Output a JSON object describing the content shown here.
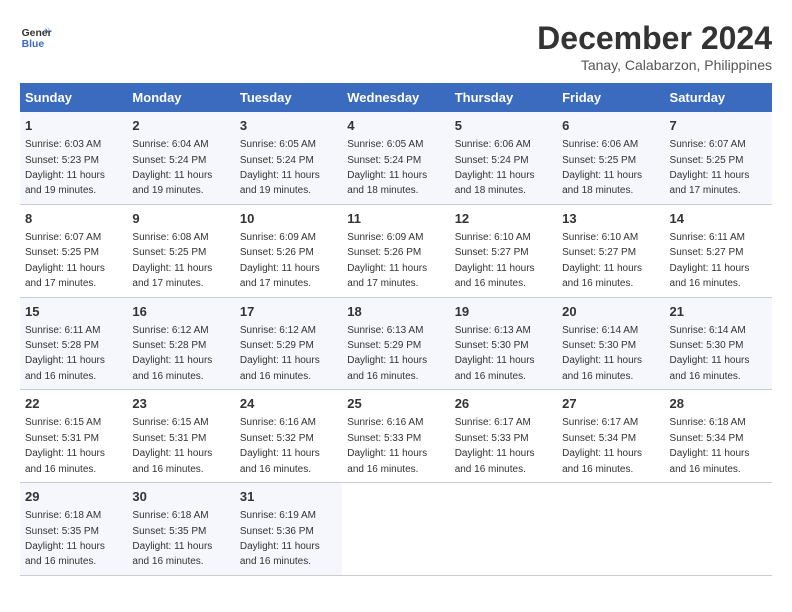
{
  "header": {
    "logo_line1": "General",
    "logo_line2": "Blue",
    "month_year": "December 2024",
    "location": "Tanay, Calabarzon, Philippines"
  },
  "weekdays": [
    "Sunday",
    "Monday",
    "Tuesday",
    "Wednesday",
    "Thursday",
    "Friday",
    "Saturday"
  ],
  "weeks": [
    [
      {
        "day": "1",
        "rise": "6:03 AM",
        "set": "5:23 PM",
        "daylight": "11 hours and 19 minutes."
      },
      {
        "day": "2",
        "rise": "6:04 AM",
        "set": "5:24 PM",
        "daylight": "11 hours and 19 minutes."
      },
      {
        "day": "3",
        "rise": "6:05 AM",
        "set": "5:24 PM",
        "daylight": "11 hours and 19 minutes."
      },
      {
        "day": "4",
        "rise": "6:05 AM",
        "set": "5:24 PM",
        "daylight": "11 hours and 18 minutes."
      },
      {
        "day": "5",
        "rise": "6:06 AM",
        "set": "5:24 PM",
        "daylight": "11 hours and 18 minutes."
      },
      {
        "day": "6",
        "rise": "6:06 AM",
        "set": "5:25 PM",
        "daylight": "11 hours and 18 minutes."
      },
      {
        "day": "7",
        "rise": "6:07 AM",
        "set": "5:25 PM",
        "daylight": "11 hours and 17 minutes."
      }
    ],
    [
      {
        "day": "8",
        "rise": "6:07 AM",
        "set": "5:25 PM",
        "daylight": "11 hours and 17 minutes."
      },
      {
        "day": "9",
        "rise": "6:08 AM",
        "set": "5:25 PM",
        "daylight": "11 hours and 17 minutes."
      },
      {
        "day": "10",
        "rise": "6:09 AM",
        "set": "5:26 PM",
        "daylight": "11 hours and 17 minutes."
      },
      {
        "day": "11",
        "rise": "6:09 AM",
        "set": "5:26 PM",
        "daylight": "11 hours and 17 minutes."
      },
      {
        "day": "12",
        "rise": "6:10 AM",
        "set": "5:27 PM",
        "daylight": "11 hours and 16 minutes."
      },
      {
        "day": "13",
        "rise": "6:10 AM",
        "set": "5:27 PM",
        "daylight": "11 hours and 16 minutes."
      },
      {
        "day": "14",
        "rise": "6:11 AM",
        "set": "5:27 PM",
        "daylight": "11 hours and 16 minutes."
      }
    ],
    [
      {
        "day": "15",
        "rise": "6:11 AM",
        "set": "5:28 PM",
        "daylight": "11 hours and 16 minutes."
      },
      {
        "day": "16",
        "rise": "6:12 AM",
        "set": "5:28 PM",
        "daylight": "11 hours and 16 minutes."
      },
      {
        "day": "17",
        "rise": "6:12 AM",
        "set": "5:29 PM",
        "daylight": "11 hours and 16 minutes."
      },
      {
        "day": "18",
        "rise": "6:13 AM",
        "set": "5:29 PM",
        "daylight": "11 hours and 16 minutes."
      },
      {
        "day": "19",
        "rise": "6:13 AM",
        "set": "5:30 PM",
        "daylight": "11 hours and 16 minutes."
      },
      {
        "day": "20",
        "rise": "6:14 AM",
        "set": "5:30 PM",
        "daylight": "11 hours and 16 minutes."
      },
      {
        "day": "21",
        "rise": "6:14 AM",
        "set": "5:30 PM",
        "daylight": "11 hours and 16 minutes."
      }
    ],
    [
      {
        "day": "22",
        "rise": "6:15 AM",
        "set": "5:31 PM",
        "daylight": "11 hours and 16 minutes."
      },
      {
        "day": "23",
        "rise": "6:15 AM",
        "set": "5:31 PM",
        "daylight": "11 hours and 16 minutes."
      },
      {
        "day": "24",
        "rise": "6:16 AM",
        "set": "5:32 PM",
        "daylight": "11 hours and 16 minutes."
      },
      {
        "day": "25",
        "rise": "6:16 AM",
        "set": "5:33 PM",
        "daylight": "11 hours and 16 minutes."
      },
      {
        "day": "26",
        "rise": "6:17 AM",
        "set": "5:33 PM",
        "daylight": "11 hours and 16 minutes."
      },
      {
        "day": "27",
        "rise": "6:17 AM",
        "set": "5:34 PM",
        "daylight": "11 hours and 16 minutes."
      },
      {
        "day": "28",
        "rise": "6:18 AM",
        "set": "5:34 PM",
        "daylight": "11 hours and 16 minutes."
      }
    ],
    [
      {
        "day": "29",
        "rise": "6:18 AM",
        "set": "5:35 PM",
        "daylight": "11 hours and 16 minutes."
      },
      {
        "day": "30",
        "rise": "6:18 AM",
        "set": "5:35 PM",
        "daylight": "11 hours and 16 minutes."
      },
      {
        "day": "31",
        "rise": "6:19 AM",
        "set": "5:36 PM",
        "daylight": "11 hours and 16 minutes."
      },
      null,
      null,
      null,
      null
    ]
  ]
}
